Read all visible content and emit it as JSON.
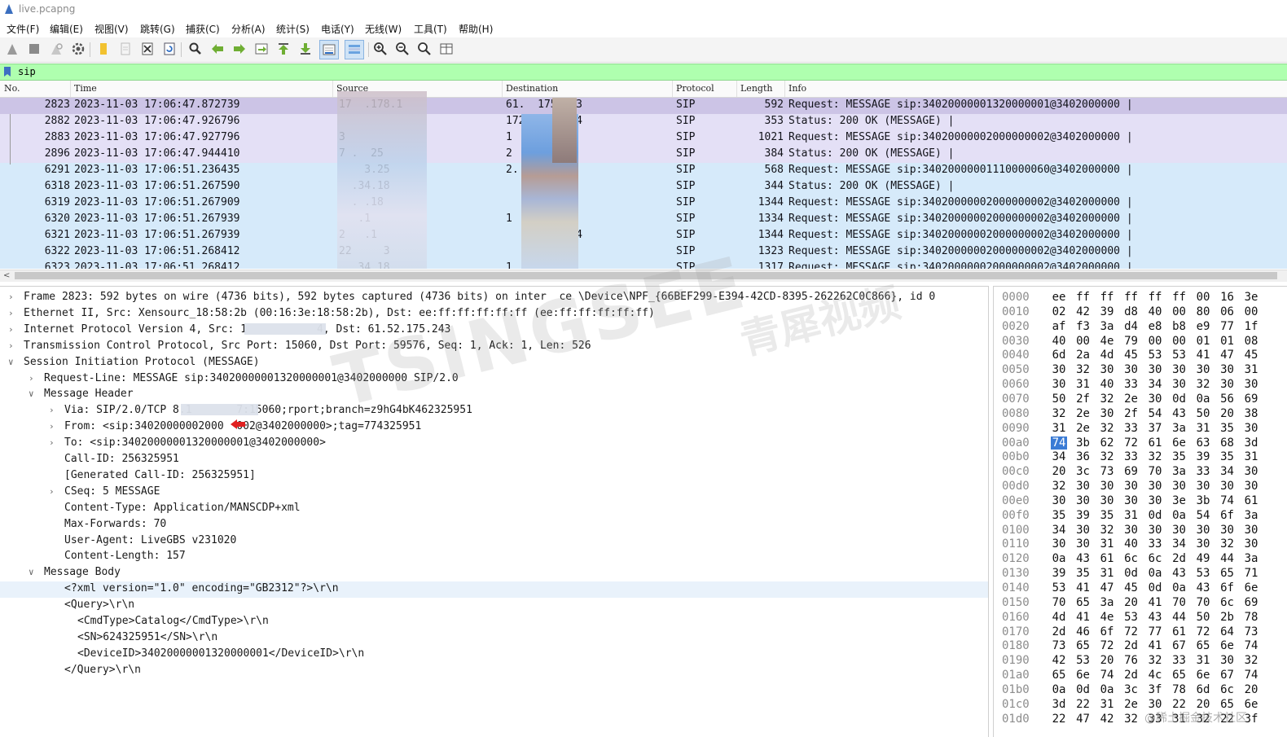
{
  "window": {
    "title": "live.pcapng"
  },
  "menu": [
    "文件(F)",
    "编辑(E)",
    "视图(V)",
    "跳转(G)",
    "捕获(C)",
    "分析(A)",
    "统计(S)",
    "电话(Y)",
    "无线(W)",
    "工具(T)",
    "帮助(H)"
  ],
  "toolbar": {
    "icons": [
      "shark-fin-start-icon",
      "stop-icon",
      "restart-icon",
      "options-gear-icon",
      "open-folder-icon",
      "save-icon",
      "close-file-icon",
      "reload-icon",
      "find-icon",
      "go-back-icon",
      "go-forward-icon",
      "go-to-packet-icon",
      "first-packet-icon",
      "last-packet-icon",
      "autoscroll-icon",
      "colorize-icon",
      "zoom-in-icon",
      "zoom-out-icon",
      "normal-size-icon",
      "resize-columns-icon"
    ]
  },
  "filter": {
    "value": "sip"
  },
  "packet_list": {
    "columns": [
      "No.",
      "Time",
      "Source",
      "Destination",
      "Protocol",
      "Length",
      "Info"
    ],
    "rows": [
      {
        "no": "2823",
        "time": "2023-11-03 17:06:47.872739",
        "src": "17  .178.1",
        "dst": "61.  175.243",
        "proto": "SIP",
        "len": "592",
        "info": "Request: MESSAGE sip:34020000001320000001@3402000000 |",
        "color": "selected"
      },
      {
        "no": "2882",
        "time": "2023-11-03 17:06:47.926796",
        "src": "",
        "dst": "172.3   .254",
        "proto": "SIP",
        "len": "353",
        "info": "Status: 200 OK (MESSAGE) |",
        "color": "lavender"
      },
      {
        "no": "2883",
        "time": "2023-11-03 17:06:47.927796",
        "src": "3",
        "dst": "1     .254",
        "proto": "SIP",
        "len": "1021",
        "info": "Request: MESSAGE sip:34020000002000000002@3402000000 |",
        "color": "lavender"
      },
      {
        "no": "2896",
        "time": "2023-11-03 17:06:47.944410",
        "src": "7 .  25",
        "dst": "2     .43",
        "proto": "SIP",
        "len": "384",
        "info": "Status: 200 OK (MESSAGE) |",
        "color": "lavender"
      },
      {
        "no": "6291",
        "time": "2023-11-03 17:06:51.236435",
        "src": "    3.25",
        "dst": "2.     18",
        "proto": "SIP",
        "len": "568",
        "info": "Request: MESSAGE sip:34020000001110000060@3402000000 |",
        "color": "blue"
      },
      {
        "no": "6318",
        "time": "2023-11-03 17:06:51.267590",
        "src": "  .34.18",
        "dst": "       254",
        "proto": "SIP",
        "len": "344",
        "info": "Status: 200 OK (MESSAGE) |",
        "color": "blue"
      },
      {
        "no": "6319",
        "time": "2023-11-03 17:06:51.267909",
        "src": "  . .18",
        "dst": "       254",
        "proto": "SIP",
        "len": "1344",
        "info": "Request: MESSAGE sip:34020000002000000002@3402000000 |",
        "color": "blue"
      },
      {
        "no": "6320",
        "time": "2023-11-03 17:06:51.267939",
        "src": "   .1",
        "dst": "1      254",
        "proto": "SIP",
        "len": "1334",
        "info": "Request: MESSAGE sip:34020000002000000002@3402000000 |",
        "color": "blue"
      },
      {
        "no": "6321",
        "time": "2023-11-03 17:06:51.267939",
        "src": "2   .1",
        "dst": "     .78.254",
        "proto": "SIP",
        "len": "1344",
        "info": "Request: MESSAGE sip:34020000002000000002@3402000000 |",
        "color": "blue"
      },
      {
        "no": "6322",
        "time": "2023-11-03 17:06:51.268412",
        "src": "22     3",
        "dst": "     78.254",
        "proto": "SIP",
        "len": "1323",
        "info": "Request: MESSAGE sip:34020000002000000002@3402000000 |",
        "color": "blue"
      },
      {
        "no": "6323",
        "time": "2023-11-03 17:06:51.268412",
        "src": "   34.18",
        "dst": "1.     254",
        "proto": "SIP",
        "len": "1317",
        "info": "Request: MESSAGE sip:34020000002000000002@3402000000 |",
        "color": "blue"
      }
    ]
  },
  "details": [
    {
      "arrow": ">",
      "indent": 0,
      "text": "Frame 2823: 592 bytes on wire (4736 bits), 592 bytes captured (4736 bits) on inter  ce \\Device\\NPF_{66BEF299-E394-42CD-8395-262262C0C866}, id 0"
    },
    {
      "arrow": ">",
      "indent": 0,
      "text": "Ethernet II, Src: Xensourc_18:58:2b (00:16:3e:18:58:2b), Dst: ee:ff:ff:ff:ff:ff (ee:ff:ff:ff:ff:ff)"
    },
    {
      "arrow": ">",
      "indent": 0,
      "text": "Internet Protocol Version 4, Src: 1           4, Dst: 61.52.175.243"
    },
    {
      "arrow": ">",
      "indent": 0,
      "text": "Transmission Control Protocol, Src Port: 15060, Dst Port: 59576, Seq: 1, Ack: 1, Len: 526"
    },
    {
      "arrow": "v",
      "indent": 0,
      "text": "Session Initiation Protocol (MESSAGE)"
    },
    {
      "arrow": ">",
      "indent": 1,
      "text": "Request-Line: MESSAGE sip:34020000001320000001@3402000000 SIP/2.0"
    },
    {
      "arrow": "v",
      "indent": 1,
      "text": "Message Header"
    },
    {
      "arrow": ">",
      "indent": 2,
      "text": "Via: SIP/2.0/TCP 8.1       7:15060;rport;branch=z9hG4bK462325951"
    },
    {
      "arrow": ">",
      "indent": 2,
      "text": "From: <sip:34020000002000  002@3402000000>;tag=774325951"
    },
    {
      "arrow": ">",
      "indent": 2,
      "text": "To: <sip:34020000001320000001@3402000000>"
    },
    {
      "arrow": "",
      "indent": 2,
      "text": "Call-ID: 256325951"
    },
    {
      "arrow": "",
      "indent": 2,
      "text": "[Generated Call-ID: 256325951]"
    },
    {
      "arrow": ">",
      "indent": 2,
      "text": "CSeq: 5 MESSAGE"
    },
    {
      "arrow": "",
      "indent": 2,
      "text": "Content-Type: Application/MANSCDP+xml"
    },
    {
      "arrow": "",
      "indent": 2,
      "text": "Max-Forwards: 70"
    },
    {
      "arrow": "",
      "indent": 2,
      "text": "User-Agent: LiveGBS v231020"
    },
    {
      "arrow": "",
      "indent": 2,
      "text": "Content-Length: 157"
    },
    {
      "arrow": "v",
      "indent": 1,
      "text": "Message Body"
    },
    {
      "arrow": "",
      "indent": 2,
      "text": "<?xml version=\"1.0\" encoding=\"GB2312\"?>\\r\\n",
      "highlight": true
    },
    {
      "arrow": "",
      "indent": 2,
      "text": "<Query>\\r\\n"
    },
    {
      "arrow": "",
      "indent": 3,
      "text": "<CmdType>Catalog</CmdType>\\r\\n"
    },
    {
      "arrow": "",
      "indent": 3,
      "text": "<SN>624325951</SN>\\r\\n"
    },
    {
      "arrow": "",
      "indent": 3,
      "text": "<DeviceID>34020000001320000001</DeviceID>\\r\\n"
    },
    {
      "arrow": "",
      "indent": 2,
      "text": "</Query>\\r\\n"
    }
  ],
  "hex": [
    {
      "off": "0000",
      "bytes": [
        "ee",
        "ff",
        "ff",
        "ff",
        "ff",
        "ff",
        "00",
        "16",
        "3e"
      ]
    },
    {
      "off": "0010",
      "bytes": [
        "02",
        "42",
        "39",
        "d8",
        "40",
        "00",
        "80",
        "06",
        "00"
      ]
    },
    {
      "off": "0020",
      "bytes": [
        "af",
        "f3",
        "3a",
        "d4",
        "e8",
        "b8",
        "e9",
        "77",
        "1f"
      ]
    },
    {
      "off": "0030",
      "bytes": [
        "40",
        "00",
        "4e",
        "79",
        "00",
        "00",
        "01",
        "01",
        "08"
      ]
    },
    {
      "off": "0040",
      "bytes": [
        "6d",
        "2a",
        "4d",
        "45",
        "53",
        "53",
        "41",
        "47",
        "45"
      ]
    },
    {
      "off": "0050",
      "bytes": [
        "30",
        "32",
        "30",
        "30",
        "30",
        "30",
        "30",
        "30",
        "31"
      ]
    },
    {
      "off": "0060",
      "bytes": [
        "30",
        "31",
        "40",
        "33",
        "34",
        "30",
        "32",
        "30",
        "30"
      ]
    },
    {
      "off": "0070",
      "bytes": [
        "50",
        "2f",
        "32",
        "2e",
        "30",
        "0d",
        "0a",
        "56",
        "69"
      ]
    },
    {
      "off": "0080",
      "bytes": [
        "32",
        "2e",
        "30",
        "2f",
        "54",
        "43",
        "50",
        "20",
        "38"
      ]
    },
    {
      "off": "0090",
      "bytes": [
        "31",
        "2e",
        "32",
        "33",
        "37",
        "3a",
        "31",
        "35",
        "30"
      ]
    },
    {
      "off": "00a0",
      "bytes": [
        "74",
        "3b",
        "62",
        "72",
        "61",
        "6e",
        "63",
        "68",
        "3d"
      ],
      "sel": 0
    },
    {
      "off": "00b0",
      "bytes": [
        "34",
        "36",
        "32",
        "33",
        "32",
        "35",
        "39",
        "35",
        "31"
      ]
    },
    {
      "off": "00c0",
      "bytes": [
        "20",
        "3c",
        "73",
        "69",
        "70",
        "3a",
        "33",
        "34",
        "30"
      ]
    },
    {
      "off": "00d0",
      "bytes": [
        "32",
        "30",
        "30",
        "30",
        "30",
        "30",
        "30",
        "30",
        "30"
      ]
    },
    {
      "off": "00e0",
      "bytes": [
        "30",
        "30",
        "30",
        "30",
        "30",
        "3e",
        "3b",
        "74",
        "61"
      ]
    },
    {
      "off": "00f0",
      "bytes": [
        "35",
        "39",
        "35",
        "31",
        "0d",
        "0a",
        "54",
        "6f",
        "3a"
      ]
    },
    {
      "off": "0100",
      "bytes": [
        "34",
        "30",
        "32",
        "30",
        "30",
        "30",
        "30",
        "30",
        "30"
      ]
    },
    {
      "off": "0110",
      "bytes": [
        "30",
        "30",
        "31",
        "40",
        "33",
        "34",
        "30",
        "32",
        "30"
      ]
    },
    {
      "off": "0120",
      "bytes": [
        "0a",
        "43",
        "61",
        "6c",
        "6c",
        "2d",
        "49",
        "44",
        "3a"
      ]
    },
    {
      "off": "0130",
      "bytes": [
        "39",
        "35",
        "31",
        "0d",
        "0a",
        "43",
        "53",
        "65",
        "71"
      ]
    },
    {
      "off": "0140",
      "bytes": [
        "53",
        "41",
        "47",
        "45",
        "0d",
        "0a",
        "43",
        "6f",
        "6e"
      ]
    },
    {
      "off": "0150",
      "bytes": [
        "70",
        "65",
        "3a",
        "20",
        "41",
        "70",
        "70",
        "6c",
        "69"
      ]
    },
    {
      "off": "0160",
      "bytes": [
        "4d",
        "41",
        "4e",
        "53",
        "43",
        "44",
        "50",
        "2b",
        "78"
      ]
    },
    {
      "off": "0170",
      "bytes": [
        "2d",
        "46",
        "6f",
        "72",
        "77",
        "61",
        "72",
        "64",
        "73"
      ]
    },
    {
      "off": "0180",
      "bytes": [
        "73",
        "65",
        "72",
        "2d",
        "41",
        "67",
        "65",
        "6e",
        "74"
      ]
    },
    {
      "off": "0190",
      "bytes": [
        "42",
        "53",
        "20",
        "76",
        "32",
        "33",
        "31",
        "30",
        "32"
      ]
    },
    {
      "off": "01a0",
      "bytes": [
        "65",
        "6e",
        "74",
        "2d",
        "4c",
        "65",
        "6e",
        "67",
        "74"
      ]
    },
    {
      "off": "01b0",
      "bytes": [
        "0a",
        "0d",
        "0a",
        "3c",
        "3f",
        "78",
        "6d",
        "6c",
        "20"
      ]
    },
    {
      "off": "01c0",
      "bytes": [
        "3d",
        "22",
        "31",
        "2e",
        "30",
        "22",
        "20",
        "65",
        "6e"
      ]
    },
    {
      "off": "01d0",
      "bytes": [
        "22",
        "47",
        "42",
        "32",
        "33",
        "31",
        "32",
        "22",
        "3f"
      ]
    }
  ],
  "watermark": {
    "main": "TSINGSEE",
    "cn": "青犀视频",
    "corner": "@稀土掘金技术社区"
  },
  "colors": {
    "filter_ok": "#afffaf",
    "row_selected": "#ccc4e6",
    "row_lavender": "#e4e0f6",
    "row_blue": "#d6eafa",
    "hex_selected": "#3a7bd5"
  }
}
